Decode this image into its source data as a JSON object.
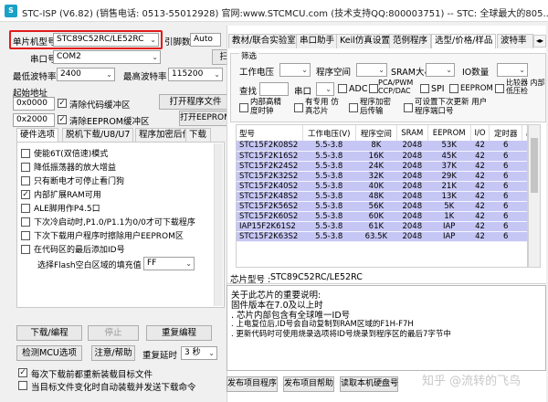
{
  "title": {
    "icon_text": "S",
    "text": "STC-ISP (V6.82) (销售电话: 0513-55012928) 官网:www.STCMCU.com (技术支持QQ:800003751) -- STC: 全球最大的805..."
  },
  "left": {
    "mcu_label": "单片机型号",
    "mcu_value": "STC89C52RC/LE52RC",
    "pin_label": "引脚数",
    "pin_value": "Auto",
    "port_label": "串口号",
    "port_value": "COM2",
    "scan_button": "扫描",
    "min_baud_label": "最低波特率",
    "min_baud_value": "2400",
    "max_baud_label": "最高波特率",
    "max_baud_value": "115200",
    "start_addr_label": "起始地址",
    "addr1": "0x0000",
    "clear_code_label": "清除代码缓冲区",
    "open_program_button": "打开程序文件",
    "addr2": "0x2000",
    "clear_eeprom_label": "清除EEPROM缓冲区",
    "open_eeprom_button": "打开EEPROM文件",
    "hw_tabs": [
      "硬件选项",
      "脱机下载/U8/U7",
      "程序加密后传输",
      "下载"
    ],
    "options": [
      {
        "label": "使能6T(双倍速)模式",
        "checked": false
      },
      {
        "label": "降低振荡器的放大增益",
        "checked": false
      },
      {
        "label": "只有断电才可停止看门狗",
        "checked": false
      },
      {
        "label": "内部扩展RAM可用",
        "checked": true
      },
      {
        "label": "ALE脚用作P4.5口",
        "checked": false
      },
      {
        "label": "下次冷启动时,P1.0/P1.1为0/0才可下载程序",
        "checked": false
      },
      {
        "label": "下次下载用户程序时擦除用户EEPROM区",
        "checked": false
      },
      {
        "label": "在代码区的最后添加ID号",
        "checked": false
      }
    ],
    "fill_label": "选择Flash空白区域的填充值",
    "fill_value": "FF",
    "download_button": "下载/编程",
    "stop_button": "停止",
    "reprogram_button": "重复编程",
    "detect_button": "检测MCU选项",
    "help_button": "注意/帮助",
    "delay_label": "重复延时",
    "delay_value": "3 秒",
    "reload_label": "每次下载前都重新装载目标文件",
    "autosend_label": "当目标文件变化时自动装载并发送下载命令",
    "reload_checked": true,
    "autosend_checked": false
  },
  "right": {
    "tabs": [
      "教材/联合实验室",
      "串口助手",
      "Keil仿真设置",
      "范例程序",
      "选型/价格/样品",
      "波特率"
    ],
    "filter_title": "筛选",
    "voltage_label": "工作电压",
    "program_space_label": "程序空间",
    "sram_label": "SRAM大小",
    "io_label": "IO数量",
    "search_label": "查找",
    "uart_label": "串口",
    "adc_label": "ADC",
    "pca_label": "PCA/PWM CCP/DAC",
    "spi_label": "SPI",
    "eeprom_label": "EEPROM",
    "comparator_label": "比较器 内部低压检",
    "reset_label": "内部高精 度时钟",
    "emu_label": "有专用 仿真芯片",
    "encrypt_label": "程序加密 后传输",
    "userport_label": "可设置下次更新 用户程序端口号",
    "table_headers": [
      "型号",
      "工作电压(V)",
      "程序空间",
      "SRAM",
      "EEPROM",
      "I/O",
      "定时器",
      "串"
    ],
    "table_rows": [
      [
        "STC15F2K08S2",
        "5.5-3.8",
        "8K",
        "2048",
        "53K",
        "42",
        "6"
      ],
      [
        "STC15F2K16S2",
        "5.5-3.8",
        "16K",
        "2048",
        "45K",
        "42",
        "6"
      ],
      [
        "STC15F2K24S2",
        "5.5-3.8",
        "24K",
        "2048",
        "37K",
        "42",
        "6"
      ],
      [
        "STC15F2K32S2",
        "5.5-3.8",
        "32K",
        "2048",
        "29K",
        "42",
        "6"
      ],
      [
        "STC15F2K40S2",
        "5.5-3.8",
        "40K",
        "2048",
        "21K",
        "42",
        "6"
      ],
      [
        "STC15F2K48S2",
        "5.5-3.8",
        "48K",
        "2048",
        "13K",
        "42",
        "6"
      ],
      [
        "STC15F2K56S2",
        "5.5-3.8",
        "56K",
        "2048",
        "5K",
        "42",
        "6"
      ],
      [
        "STC15F2K60S2",
        "5.5-3.8",
        "60K",
        "2048",
        "1K",
        "42",
        "6"
      ],
      [
        "IAP15F2K61S2",
        "5.5-3.8",
        "61K",
        "2048",
        "IAP",
        "42",
        "6"
      ],
      [
        "STC15F2K63S2",
        "5.5-3.8",
        "63.5K",
        "2048",
        "IAP",
        "42",
        "6"
      ]
    ],
    "chip_label": "芯片型号 :",
    "chip_value": "STC89C52RC/LE52RC",
    "info_lines": [
      "关于此芯片的重要说明:",
      "  固件版本在7.0及以上时",
      "  . 芯片内部包含有全球唯一ID号",
      "  . 上电复位后,ID号会自动复制到RAM区域的F1H-F7H",
      "  . 更新代码时可使用烧录选项将ID号烧录到程序区的最后7字节中"
    ],
    "publish_button": "发布项目程序",
    "help_button": "发布项目帮助",
    "read_id_button": "读取本机硬盘号",
    "watermark": "知乎 @流转的飞鸟"
  },
  "colors": {
    "table_row_bg": "#c6c6f4",
    "highlight_border": "#e21b1b",
    "app_icon": "#1aa1c8"
  }
}
